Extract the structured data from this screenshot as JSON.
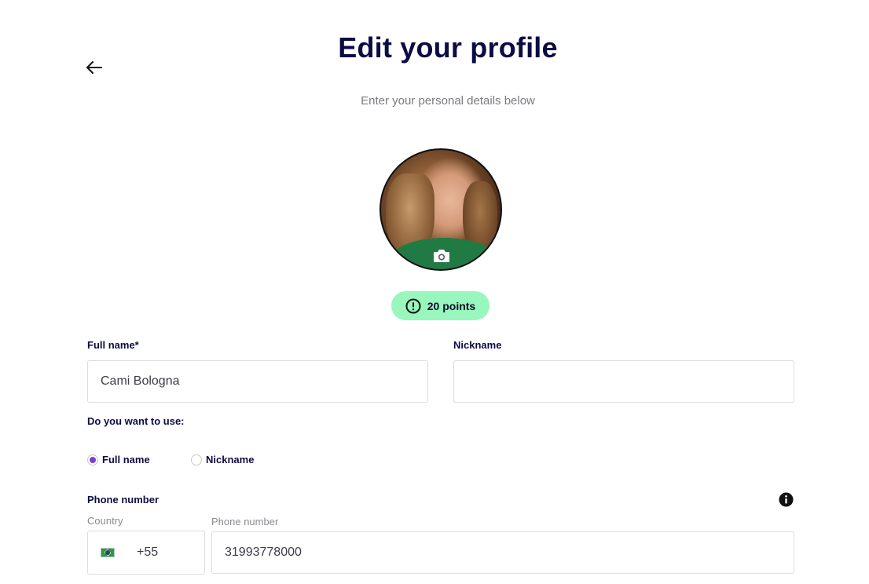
{
  "header": {
    "title": "Edit your profile",
    "subtitle": "Enter your personal details below"
  },
  "icons": {
    "back": "arrow-left-icon",
    "camera": "camera-icon",
    "alert": "exclamation-circle-icon",
    "info": "info-icon"
  },
  "points": {
    "label": "20 points",
    "color": "#98f7bd"
  },
  "form": {
    "full_name": {
      "label": "Full name*",
      "value": "Cami Bologna"
    },
    "nickname": {
      "label": "Nickname",
      "value": ""
    },
    "use_question": "Do you want to use:",
    "use_options": [
      {
        "label": "Full name",
        "checked": true
      },
      {
        "label": "Nickname",
        "checked": false
      }
    ],
    "phone": {
      "label": "Phone number",
      "country_label": "Country",
      "country_code": "+55",
      "number_label": "Phone number",
      "number_value": "31993778000"
    }
  },
  "colors": {
    "accent": "#7b3fd1",
    "title": "#0c0c45"
  }
}
